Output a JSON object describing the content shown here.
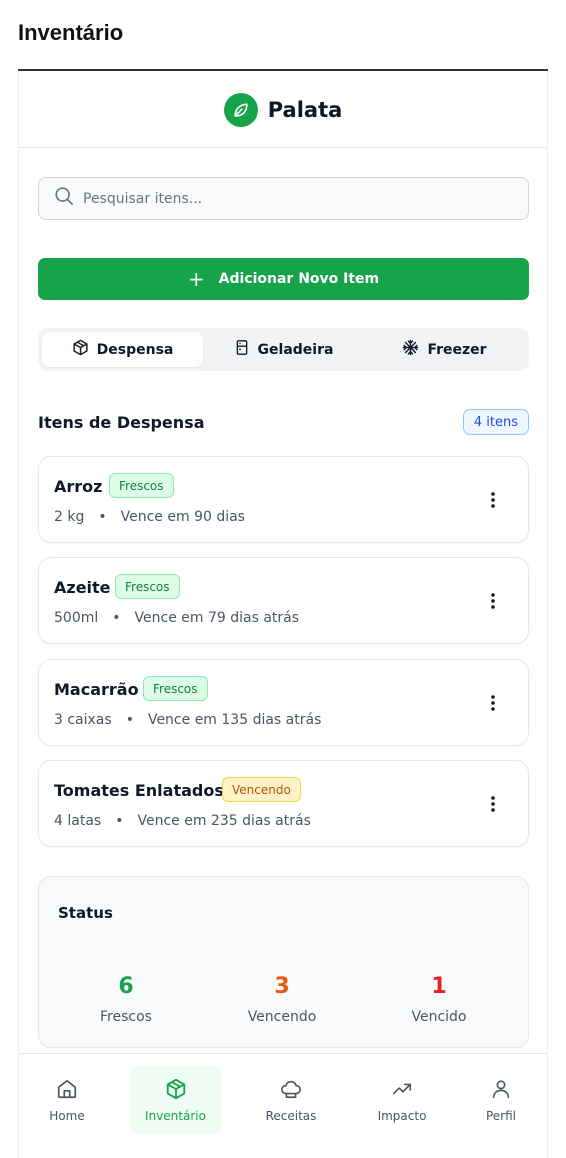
{
  "page_title": "Inventário",
  "app": {
    "name": "Palata",
    "logo_icon": "leaf-icon",
    "accent": "#16a34a"
  },
  "search": {
    "placeholder": "Pesquisar itens...",
    "value": ""
  },
  "add_button": {
    "icon": "+",
    "label": "Adicionar Novo Item"
  },
  "tabs": [
    {
      "label": "Despensa",
      "icon": "package-icon",
      "active": true
    },
    {
      "label": "Geladeira",
      "icon": "fridge-icon",
      "active": false
    },
    {
      "label": "Freezer",
      "icon": "snowflake-icon",
      "active": false
    }
  ],
  "section": {
    "title": "Itens de Despensa",
    "count_label": "4 itens"
  },
  "items": [
    {
      "name": "Arroz",
      "status": "Frescos",
      "quantity": "2 kg",
      "separator": "•",
      "expiry": "Vence em 90 dias"
    },
    {
      "name": "Azeite",
      "status": "Frescos",
      "quantity": "500ml",
      "separator": "•",
      "expiry": "Vence em 79 dias atrás"
    },
    {
      "name": "Macarrão",
      "status": "Frescos",
      "quantity": "3 caixas",
      "separator": "•",
      "expiry": "Vence em 135 dias atrás"
    },
    {
      "name": "Tomates Enlatados",
      "status": "Vencendo",
      "quantity": "4 latas",
      "separator": "•",
      "expiry": "Vence em 235 dias atrás"
    }
  ],
  "status": {
    "title": "Status",
    "stats": [
      {
        "value": "6",
        "label": "Frescos",
        "color": "#16a34a"
      },
      {
        "value": "3",
        "label": "Vencendo",
        "color": "#ea580c"
      },
      {
        "value": "1",
        "label": "Vencido",
        "color": "#dc2626"
      }
    ]
  },
  "nav": [
    {
      "label": "Home",
      "icon": "home-icon",
      "active": false
    },
    {
      "label": "Inventário",
      "icon": "box-icon",
      "active": true
    },
    {
      "label": "Receitas",
      "icon": "chef-hat-icon",
      "active": false
    },
    {
      "label": "Impacto",
      "icon": "trending-up-icon",
      "active": false
    },
    {
      "label": "Perfil",
      "icon": "user-icon",
      "active": false
    }
  ]
}
